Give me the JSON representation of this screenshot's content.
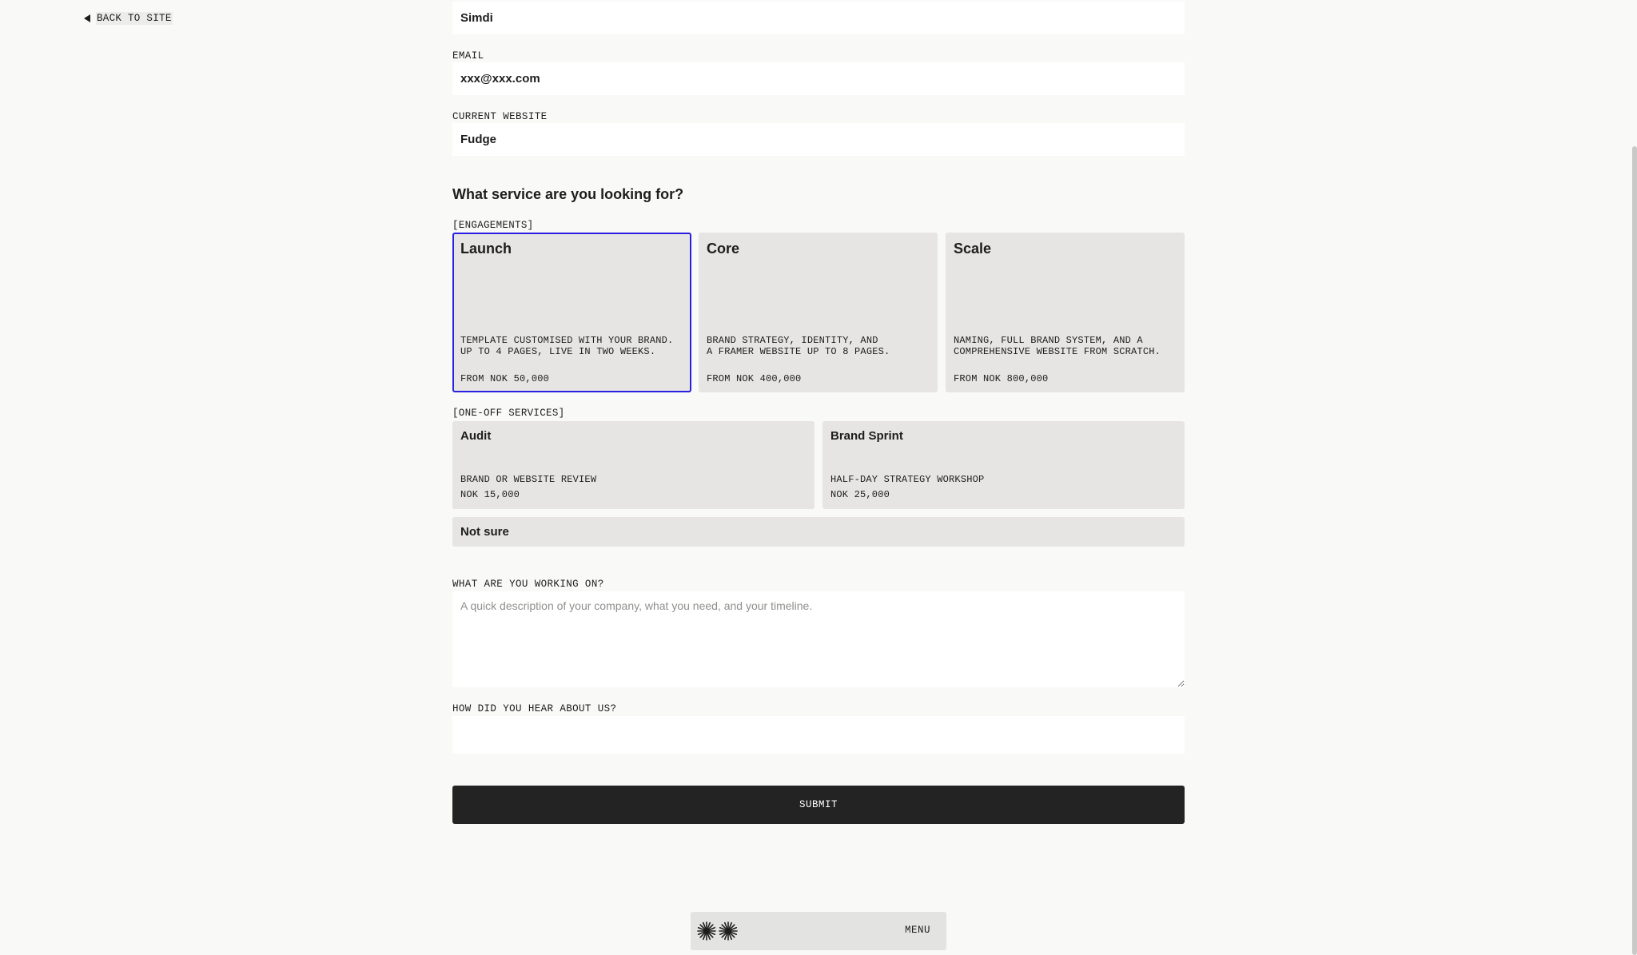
{
  "nav": {
    "back_label": "BACK TO SITE"
  },
  "form": {
    "name_value": "Simdi",
    "email": {
      "label": "EMAIL",
      "value": "xxx@xxx.com"
    },
    "website": {
      "label": "CURRENT WEBSITE",
      "value": "Fudge"
    },
    "service_title": "What service are you looking for?",
    "engagements_label": "[ENGAGEMENTS]",
    "engagements": [
      {
        "name": "Launch",
        "desc": "TEMPLATE CUSTOMISED WITH YOUR BRAND.\nUP TO 4 PAGES, LIVE IN TWO WEEKS.",
        "price": "FROM NOK 50,000",
        "selected": true
      },
      {
        "name": "Core",
        "desc": "BRAND STRATEGY, IDENTITY, AND\nA FRAMER WEBSITE UP TO 8 PAGES.",
        "price": "FROM NOK 400,000",
        "selected": false
      },
      {
        "name": "Scale",
        "desc": "NAMING, FULL BRAND SYSTEM, AND A\nCOMPREHENSIVE WEBSITE FROM SCRATCH.",
        "price": "FROM NOK 800,000",
        "selected": false
      }
    ],
    "oneoff_label": "[ONE-OFF SERVICES]",
    "oneoff": [
      {
        "name": "Audit",
        "desc": "BRAND OR WEBSITE REVIEW",
        "price": "NOK 15,000"
      },
      {
        "name": "Brand Sprint",
        "desc": "HALF-DAY STRATEGY WORKSHOP",
        "price": "NOK 25,000"
      }
    ],
    "not_sure": "Not sure",
    "working_on": {
      "label": "WHAT ARE YOU WORKING ON?",
      "placeholder": "A quick description of your company, what you need, and your timeline."
    },
    "hear_about": {
      "label": "HOW DID YOU HEAR ABOUT US?",
      "value": ""
    },
    "submit_label": "SUBMIT"
  },
  "menubar": {
    "menu_label": "MENU",
    "logo_icon": "asterisk-burst-icon"
  },
  "colors": {
    "accent": "#2a1ee0",
    "card_bg": "#e6e5e3",
    "page_bg": "#f9f9f7",
    "button_bg": "#232323"
  }
}
